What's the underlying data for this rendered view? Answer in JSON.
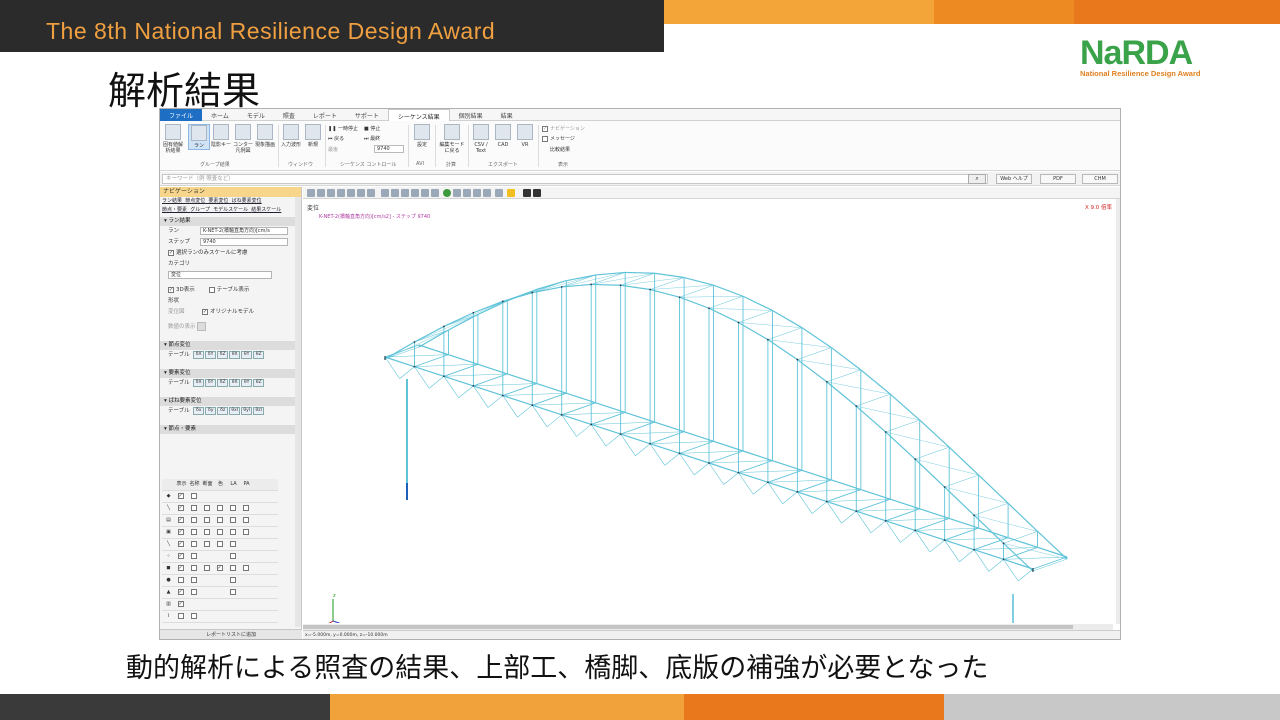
{
  "banner": {
    "title": "The 8th National Resilience Design Award"
  },
  "logo": {
    "word": "NaRDA",
    "sub": "National Resilience Design Award"
  },
  "slide_title": "解析結果",
  "caption": "動的解析による照査の結果、上部工、橋脚、底版の補強が必要となった",
  "colors": {
    "banner_bg": "#2b2b2b",
    "banner_text": "#f0a040",
    "orange": "#f08a1c",
    "logo_green": "#3aa34a",
    "model_line": "#5fc3d8",
    "pier_blue": "#1f5fb8"
  },
  "app": {
    "tabs": [
      "ファイル",
      "ホーム",
      "モデル",
      "照査",
      "レポート",
      "サポート",
      "シーケンス結果",
      "個別結果",
      "結果"
    ],
    "active_tab": "シーケンス結果",
    "ribbon": {
      "buttons": [
        "固有値解析結果",
        "ラン",
        "陰影キー",
        "コンター凡例図",
        "現象描画",
        "入力波形",
        "新規"
      ],
      "groups": [
        "グループ結果",
        "ウィンドウ",
        "シーケンス コントロール",
        "AVI",
        "計算",
        "エクスポート",
        "表示"
      ],
      "pause_label": "一時停止",
      "stop_label": "停止",
      "back_label": "戻る",
      "end_label": "最終",
      "step_label": "最後",
      "step_value": "9740",
      "settings_label": "設定",
      "edit_mode_label": "編集モードに戻る",
      "csv_label": "CSV / Text",
      "cad_label": "CAD",
      "vr_label": "VR",
      "nav_check": "ナビゲーション",
      "msg_check": "メッセージ",
      "compare_label": "比較結果"
    },
    "keyword_placeholder": "キーワード（例 照査など）",
    "help_buttons": [
      "Web ヘルプ",
      "PDF",
      "CHM"
    ],
    "nav": {
      "title": "ナビゲーション",
      "links_1": [
        "ラン結果",
        "節点変位",
        "要素変位",
        "ばね要素変位"
      ],
      "links_2": [
        "節点・要素",
        "グループ",
        "モデルスケール",
        "結果スケール"
      ],
      "run_section": "ラン結果",
      "run_label": "ラン",
      "run_value": "K-NET-2(橋軸直角方向)[cm/s",
      "step_label": "ステップ",
      "step_value": "9740",
      "scale_check": "選択ランのみスケールに考慮",
      "category_label": "カテゴリ",
      "category_value": "変位",
      "show3d": "3D表示",
      "table_show": "テーブル表示",
      "shape_label": "形状",
      "deformed": "変位図",
      "original_model": "オリジナルモデル",
      "value_show": "数値の表示",
      "node_disp": "節点変位",
      "elem_disp": "要素変位",
      "spring_disp": "ばね要素変位",
      "table_label": "テーブル",
      "node_buttons": [
        "δX",
        "δY",
        "δZ",
        "θX",
        "θY",
        "θZ"
      ],
      "spring_buttons": [
        "δx",
        "δy",
        "δz",
        "θxl",
        "θyl",
        "θzl"
      ],
      "node_elem": "節点・要素",
      "grid_headers": [
        "表示",
        "名称",
        "断面",
        "色",
        "LA",
        "PA"
      ],
      "footer": "レポートリストに追加"
    },
    "viewport": {
      "label": "変位",
      "run_info": "K-NET-2(橋軸直角方向)[cm/s2] - ステップ 9740",
      "scale": "X 9.0 倍率",
      "status": "x=-5.000m, y=0.000m, z=-10.000m"
    }
  }
}
